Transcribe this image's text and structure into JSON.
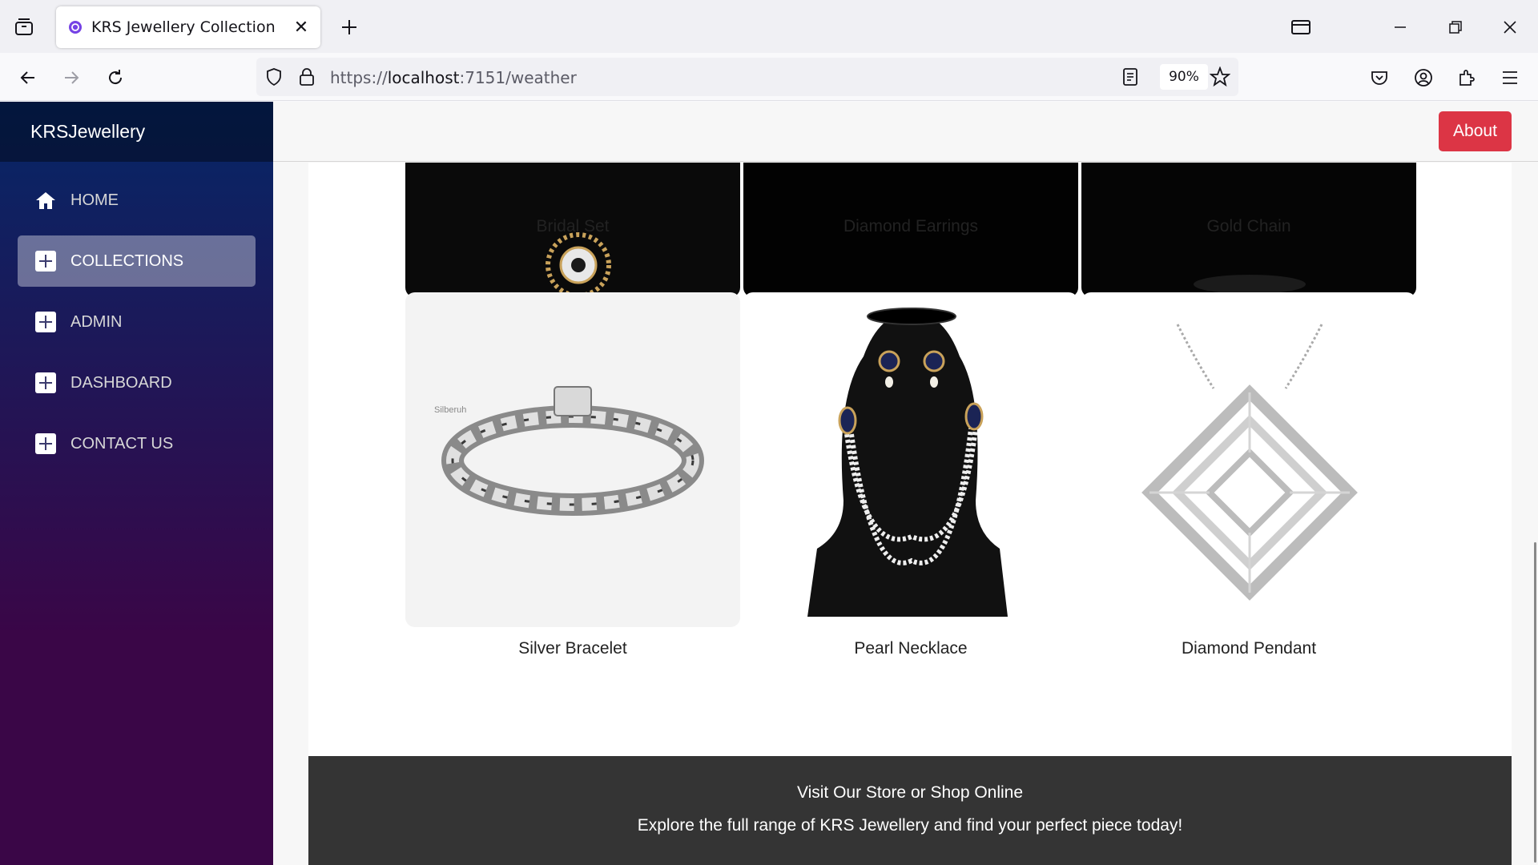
{
  "browser": {
    "tab_title": "KRS Jewellery Collection",
    "url_scheme": "https://",
    "url_host": "localhost",
    "url_path": ":7151/weather",
    "zoom": "90%"
  },
  "app": {
    "brand": "KRSJewellery",
    "about_label": "About",
    "nav": [
      {
        "label": "HOME",
        "icon": "home-icon"
      },
      {
        "label": "COLLECTIONS",
        "icon": "plus-icon",
        "active": true
      },
      {
        "label": "ADMIN",
        "icon": "plus-icon"
      },
      {
        "label": "DASHBOARD",
        "icon": "plus-icon"
      },
      {
        "label": "CONTACT US",
        "icon": "plus-icon"
      }
    ]
  },
  "products_top": [
    {
      "name": "Bridal Set"
    },
    {
      "name": "Diamond Earrings"
    },
    {
      "name": "Gold Chain"
    }
  ],
  "products": [
    {
      "name": "Silver Bracelet",
      "watermark": "Silberuh"
    },
    {
      "name": "Pearl Necklace"
    },
    {
      "name": "Diamond Pendant"
    }
  ],
  "footer": {
    "title": "Visit Our Store or Shop Online",
    "subtitle": "Explore the full range of KRS Jewellery and find your perfect piece today!"
  },
  "colors": {
    "about_button": "#dc3545",
    "sidebar_top": "#052767",
    "sidebar_bottom": "#3a0647",
    "footer_bg": "#343434"
  }
}
